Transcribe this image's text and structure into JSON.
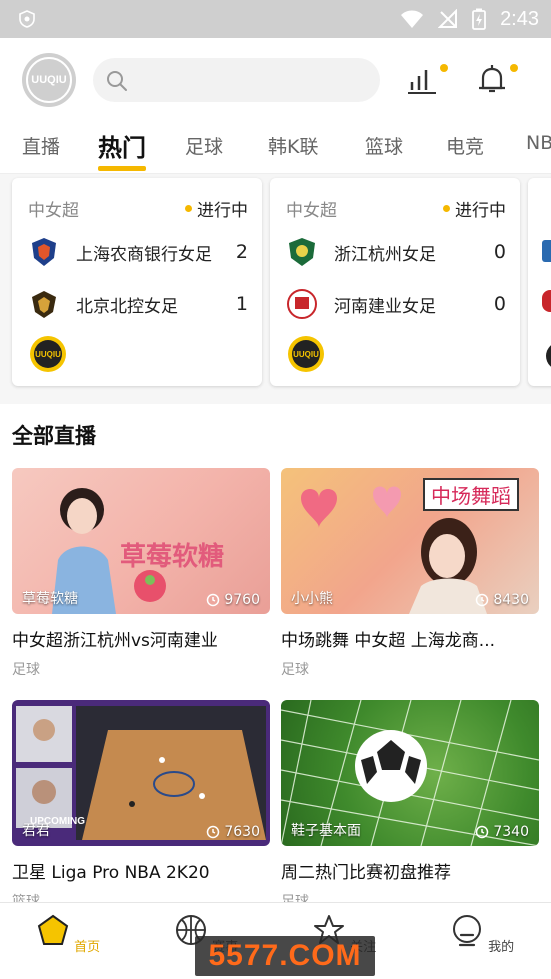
{
  "status_bar": {
    "time": "2:43"
  },
  "header": {
    "logo_text": "UUQIU"
  },
  "tabs": [
    "直播",
    "热门",
    "足球",
    "韩K联",
    "篮球",
    "电竞",
    "NBA"
  ],
  "active_tab": "热门",
  "matches": [
    {
      "league": "中女超",
      "status": "进行中",
      "home": {
        "name": "上海农商银行女足",
        "score": "2"
      },
      "away": {
        "name": "北京北控女足",
        "score": "1"
      }
    },
    {
      "league": "中女超",
      "status": "进行中",
      "home": {
        "name": "浙江杭州女足",
        "score": "0"
      },
      "away": {
        "name": "河南建业女足",
        "score": "0"
      }
    }
  ],
  "section_title": "全部直播",
  "streams": [
    {
      "title": "中女超浙江杭州vs河南建业",
      "category": "足球",
      "streamer": "草莓软糖",
      "views": "9760",
      "overlay_text": "草莓软糖"
    },
    {
      "title": "中场跳舞 中女超 上海龙商...",
      "category": "足球",
      "streamer": "小小熊",
      "views": "8430",
      "overlay_text": "中场舞蹈"
    },
    {
      "title": "卫星 Liga Pro NBA 2K20",
      "category": "篮球",
      "streamer": "君君",
      "views": "7630",
      "overlay_text": "UPCOMING"
    },
    {
      "title": "周二热门比赛初盘推荐",
      "category": "足球",
      "streamer": "鞋子基本面",
      "views": "7340",
      "overlay_text": ""
    }
  ],
  "bottom_nav": [
    {
      "label": "首页",
      "icon": "home-icon",
      "active": true
    },
    {
      "label": "赛事",
      "icon": "basketball-icon",
      "active": false
    },
    {
      "label": "关注",
      "icon": "star-icon",
      "active": false
    },
    {
      "label": "我的",
      "icon": "profile-icon",
      "active": false
    }
  ],
  "watermark": "5577.COM",
  "colors": {
    "accent": "#f5b800",
    "status_bar": "#cfcfcf",
    "watermark_text": "#ff6a1a"
  }
}
